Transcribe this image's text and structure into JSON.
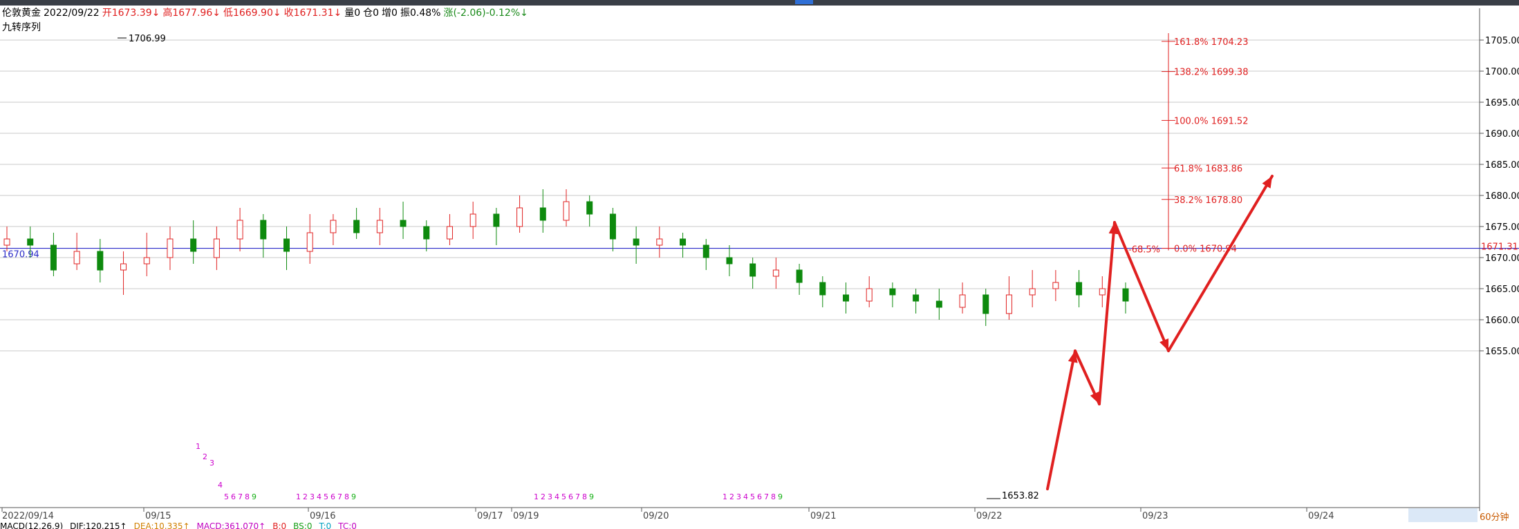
{
  "header": {
    "symbol": "伦敦黄金",
    "date": "2022/09/22",
    "open": "开1673.39↓",
    "high": "高1677.96↓",
    "low": "低1669.90↓",
    "close": "收1671.31↓",
    "volume": "量0",
    "position": "仓0",
    "increase": "增0",
    "amplitude": "振0.48%",
    "change": "涨(-2.06)-0.12%↓"
  },
  "indicator_label": "九转序列",
  "timeframe": "60分钟",
  "macd_bar": {
    "title": "MACD(12,26,9)",
    "dif": "DIF:120.215↑",
    "dea": "DEA:10.335↑",
    "macd": "MACD:361.070↑",
    "b": "B:0",
    "bs": "BS:0",
    "t": "T:0",
    "tc": "TC:0"
  },
  "colors": {
    "up": "#e02020",
    "down": "#0e8a0e",
    "grid": "#c8c8c8",
    "axis_text": "#000000",
    "current_price": "#e02020",
    "ref_line": "#2a2ac8",
    "nine_seq": "#cc00cc",
    "nine_seq_end": "#16b016"
  },
  "chart_data": {
    "type": "candlestick",
    "y_range": [
      1654,
      1708
    ],
    "y_ticks": [
      "1705.00",
      "1700.00",
      "1695.00",
      "1690.00",
      "1685.00",
      "1680.00",
      "1675.00",
      "1670.00",
      "1665.00",
      "1660.00",
      "1655.00"
    ],
    "x_labels": [
      "2022/09/14",
      "09/15",
      "09/16",
      "09/17",
      "09/19",
      "09/20",
      "09/21",
      "09/22",
      "09/23",
      "09/24"
    ],
    "current_price": "1671.31",
    "ref_price": "1670.94",
    "high_label": "1706.99",
    "low_label": "1653.82",
    "fib_levels": [
      {
        "label": "161.8% 1704.23"
      },
      {
        "label": "138.2% 1699.38"
      },
      {
        "label": "100.0% 1691.52"
      },
      {
        "label": "61.8% 1683.86"
      },
      {
        "label": "38.2% 1678.80"
      },
      {
        "label": "0.0% 1670.94"
      }
    ],
    "fib_neg": "-68.5%",
    "fib_values": [
      1704.23,
      1699.38,
      1691.52,
      1683.86,
      1678.8,
      1670.94
    ],
    "nine_seq_groups": [
      {
        "labels": [
          "1",
          "2",
          "3",
          "4",
          "5",
          "6",
          "7",
          "8",
          "9"
        ]
      },
      {
        "labels": [
          "1",
          "2",
          "3",
          "4",
          "5",
          "6",
          "7",
          "8",
          "9"
        ]
      },
      {
        "labels": [
          "1",
          "2",
          "3",
          "4",
          "5",
          "6",
          "7",
          "8",
          "9"
        ]
      },
      {
        "labels": [
          "1",
          "2",
          "3",
          "4",
          "5",
          "6",
          "7",
          "8",
          "9"
        ]
      }
    ],
    "candles": [
      [
        1672,
        1673,
        1675,
        1671
      ],
      [
        1673,
        1672,
        1675,
        1670
      ],
      [
        1672,
        1668,
        1674,
        1667
      ],
      [
        1669,
        1671,
        1674,
        1668
      ],
      [
        1671,
        1668,
        1673,
        1666
      ],
      [
        1668,
        1669,
        1671,
        1664
      ],
      [
        1669,
        1670,
        1674,
        1667
      ],
      [
        1670,
        1673,
        1675,
        1668
      ],
      [
        1673,
        1671,
        1676,
        1669
      ],
      [
        1670,
        1673,
        1675,
        1668
      ],
      [
        1673,
        1676,
        1678,
        1671
      ],
      [
        1676,
        1673,
        1677,
        1670
      ],
      [
        1673,
        1671,
        1675,
        1668
      ],
      [
        1671,
        1674,
        1677,
        1669
      ],
      [
        1674,
        1676,
        1677,
        1672
      ],
      [
        1676,
        1674,
        1678,
        1673
      ],
      [
        1674,
        1676,
        1678,
        1672
      ],
      [
        1676,
        1675,
        1679,
        1673
      ],
      [
        1675,
        1673,
        1676,
        1671
      ],
      [
        1673,
        1675,
        1677,
        1672
      ],
      [
        1675,
        1677,
        1679,
        1673
      ],
      [
        1677,
        1675,
        1678,
        1672
      ],
      [
        1675,
        1678,
        1680,
        1674
      ],
      [
        1678,
        1676,
        1681,
        1674
      ],
      [
        1676,
        1679,
        1681,
        1675
      ],
      [
        1679,
        1677,
        1680,
        1675
      ],
      [
        1677,
        1673,
        1678,
        1671
      ],
      [
        1673,
        1672,
        1675,
        1669
      ],
      [
        1672,
        1673,
        1675,
        1670
      ],
      [
        1673,
        1672,
        1674,
        1670
      ],
      [
        1672,
        1670,
        1673,
        1668
      ],
      [
        1670,
        1669,
        1672,
        1667
      ],
      [
        1669,
        1667,
        1670,
        1665
      ],
      [
        1667,
        1668,
        1670,
        1665
      ],
      [
        1668,
        1666,
        1669,
        1664
      ],
      [
        1666,
        1664,
        1667,
        1662
      ],
      [
        1664,
        1663,
        1666,
        1661
      ],
      [
        1663,
        1665,
        1667,
        1662
      ],
      [
        1665,
        1664,
        1666,
        1662
      ],
      [
        1664,
        1663,
        1665,
        1661
      ],
      [
        1663,
        1662,
        1665,
        1660
      ],
      [
        1662,
        1664,
        1666,
        1661
      ],
      [
        1664,
        1661,
        1665,
        1659
      ],
      [
        1661,
        1664,
        1667,
        1660
      ],
      [
        1664,
        1665,
        1668,
        1662
      ],
      [
        1665,
        1666,
        1668,
        1663
      ],
      [
        1666,
        1664,
        1668,
        1662
      ],
      [
        1664,
        1665,
        1667,
        1662
      ],
      [
        1665,
        1663,
        1666,
        1661
      ]
    ],
    "ma": []
  }
}
